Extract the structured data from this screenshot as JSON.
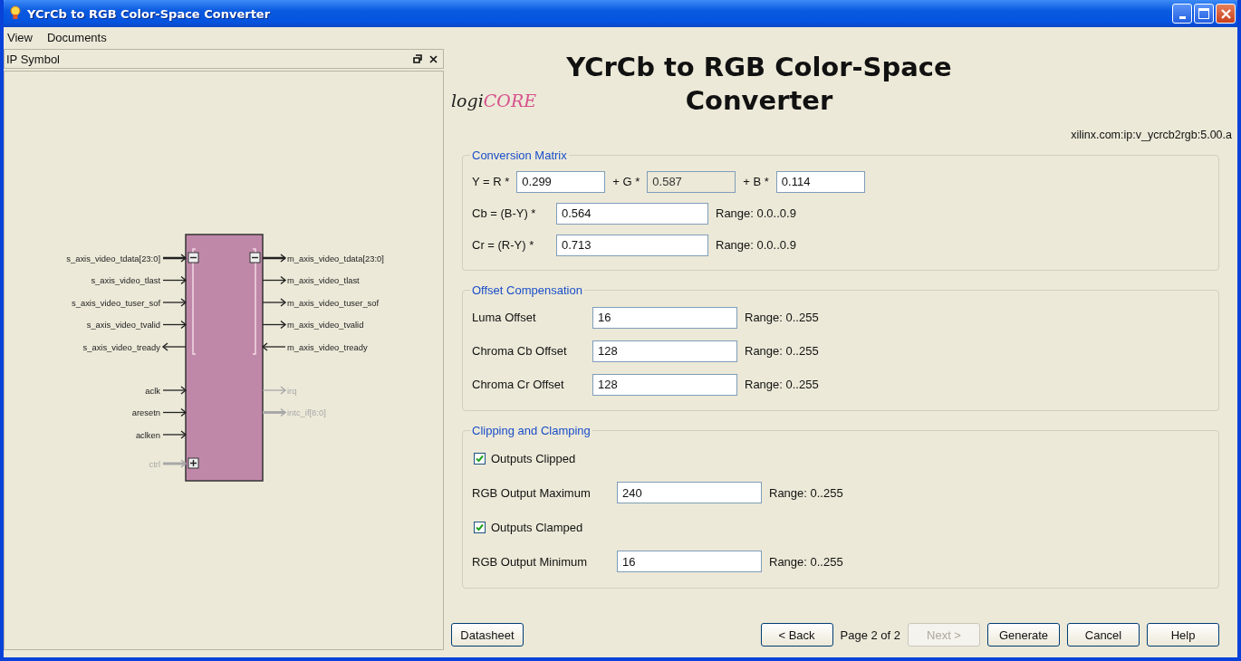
{
  "window": {
    "title": "YCrCb to RGB Color-Space Converter"
  },
  "menu": [
    "View",
    "Documents"
  ],
  "ip_symbol": {
    "title": "IP Symbol",
    "left_groups": [
      [
        {
          "name": "s_axis_video_tdata[23:0]",
          "output": false,
          "kind": "bus_group",
          "expanded": true,
          "disabled": false
        },
        {
          "name": "s_axis_video_tlast",
          "output": false,
          "kind": "signal",
          "disabled": false
        },
        {
          "name": "s_axis_video_tuser_sof",
          "output": false,
          "kind": "signal",
          "disabled": false
        },
        {
          "name": "s_axis_video_tvalid",
          "output": false,
          "kind": "signal",
          "disabled": false
        },
        {
          "name": "s_axis_video_tready",
          "output": true,
          "kind": "signal",
          "disabled": false
        }
      ],
      [
        {
          "name": "aclk",
          "output": false,
          "kind": "signal",
          "disabled": false
        },
        {
          "name": "aresetn",
          "output": false,
          "kind": "signal",
          "disabled": false
        },
        {
          "name": "aclken",
          "output": false,
          "kind": "signal",
          "disabled": false
        }
      ],
      [
        {
          "name": "ctrl",
          "output": false,
          "kind": "bus_group",
          "expanded": false,
          "disabled": true
        }
      ]
    ],
    "right_groups": [
      [
        {
          "name": "m_axis_video_tdata[23:0]",
          "output": true,
          "kind": "bus_group",
          "expanded": true,
          "disabled": false
        },
        {
          "name": "m_axis_video_tlast",
          "output": true,
          "kind": "signal",
          "disabled": false
        },
        {
          "name": "m_axis_video_tuser_sof",
          "output": true,
          "kind": "signal",
          "disabled": false
        },
        {
          "name": "m_axis_video_tvalid",
          "output": true,
          "kind": "signal",
          "disabled": false
        },
        {
          "name": "m_axis_video_tready",
          "output": false,
          "kind": "signal",
          "disabled": false
        }
      ],
      [
        {
          "name": "irq",
          "output": true,
          "kind": "signal",
          "disabled": true
        },
        {
          "name": "intc_if[8:0]",
          "output": true,
          "kind": "bus",
          "disabled": true
        }
      ]
    ]
  },
  "header": {
    "logo": "logi**CORE**",
    "title": "YCrCb to RGB Color-Space Converter",
    "vlnv": "xilinx.com:ip:v_ycrcb2rgb:5.00.a"
  },
  "conversion_matrix": {
    "legend": "Conversion Matrix",
    "y_row": [
      {
        "label": "Y = R *",
        "value": "0.299",
        "disabled": false
      },
      {
        "label": "+ G *",
        "value": "0.587",
        "disabled": true
      },
      {
        "label": "+ B *",
        "value": "0.114",
        "disabled": false
      }
    ],
    "rows": [
      {
        "label": "Cb = (B-Y) *",
        "value": "0.564",
        "range": "Range: 0.0..0.9"
      },
      {
        "label": "Cr = (R-Y) *",
        "value": "0.713",
        "range": "Range: 0.0..0.9"
      }
    ]
  },
  "offset_compensation": {
    "legend": "Offset Compensation",
    "rows": [
      {
        "label": "Luma Offset",
        "value": "16",
        "range": "Range: 0..255"
      },
      {
        "label": "Chroma Cb Offset",
        "value": "128",
        "range": "Range: 0..255"
      },
      {
        "label": "Chroma Cr Offset",
        "value": "128",
        "range": "Range: 0..255"
      }
    ]
  },
  "clipping": {
    "legend": "Clipping and Clamping",
    "items": [
      {
        "kind": "checkbox",
        "label": "Outputs Clipped",
        "checked": true
      },
      {
        "kind": "field",
        "label": "RGB Output Maximum",
        "value": "240",
        "range": "Range: 0..255"
      },
      {
        "kind": "checkbox",
        "label": "Outputs Clamped",
        "checked": true
      },
      {
        "kind": "field",
        "label": "RGB Output Minimum",
        "value": "16",
        "range": "Range: 0..255"
      }
    ]
  },
  "footer": {
    "left": [
      {
        "kind": "button",
        "label": "Datasheet",
        "disabled": false
      }
    ],
    "right": [
      {
        "kind": "button",
        "label": "< Back",
        "disabled": false
      },
      {
        "kind": "text",
        "label": "Page 2 of 2"
      },
      {
        "kind": "button",
        "label": "Next >",
        "disabled": true
      },
      {
        "kind": "button",
        "label": "Generate",
        "disabled": false
      },
      {
        "kind": "button",
        "label": "Cancel",
        "disabled": false
      },
      {
        "kind": "button",
        "label": "Help",
        "disabled": false
      }
    ]
  }
}
